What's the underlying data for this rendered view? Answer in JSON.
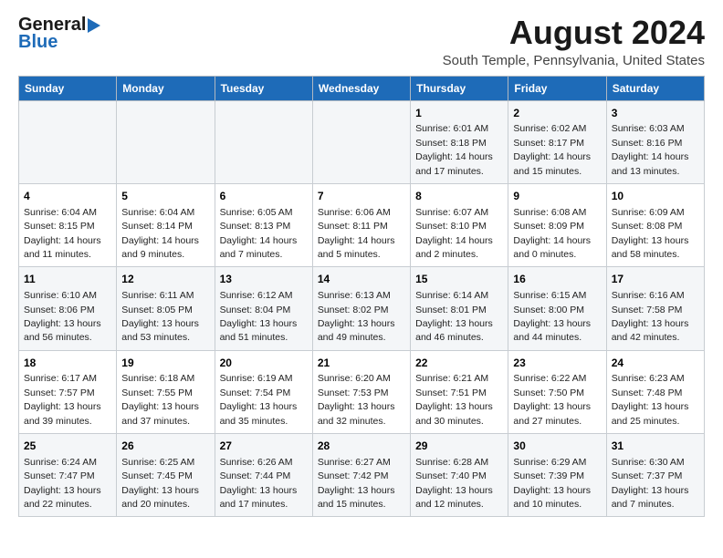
{
  "header": {
    "logo_line1": "General",
    "logo_line2": "Blue",
    "title": "August 2024",
    "subtitle": "South Temple, Pennsylvania, United States"
  },
  "calendar": {
    "days_of_week": [
      "Sunday",
      "Monday",
      "Tuesday",
      "Wednesday",
      "Thursday",
      "Friday",
      "Saturday"
    ],
    "weeks": [
      [
        {
          "day": "",
          "info": ""
        },
        {
          "day": "",
          "info": ""
        },
        {
          "day": "",
          "info": ""
        },
        {
          "day": "",
          "info": ""
        },
        {
          "day": "1",
          "info": "Sunrise: 6:01 AM\nSunset: 8:18 PM\nDaylight: 14 hours\nand 17 minutes."
        },
        {
          "day": "2",
          "info": "Sunrise: 6:02 AM\nSunset: 8:17 PM\nDaylight: 14 hours\nand 15 minutes."
        },
        {
          "day": "3",
          "info": "Sunrise: 6:03 AM\nSunset: 8:16 PM\nDaylight: 14 hours\nand 13 minutes."
        }
      ],
      [
        {
          "day": "4",
          "info": "Sunrise: 6:04 AM\nSunset: 8:15 PM\nDaylight: 14 hours\nand 11 minutes."
        },
        {
          "day": "5",
          "info": "Sunrise: 6:04 AM\nSunset: 8:14 PM\nDaylight: 14 hours\nand 9 minutes."
        },
        {
          "day": "6",
          "info": "Sunrise: 6:05 AM\nSunset: 8:13 PM\nDaylight: 14 hours\nand 7 minutes."
        },
        {
          "day": "7",
          "info": "Sunrise: 6:06 AM\nSunset: 8:11 PM\nDaylight: 14 hours\nand 5 minutes."
        },
        {
          "day": "8",
          "info": "Sunrise: 6:07 AM\nSunset: 8:10 PM\nDaylight: 14 hours\nand 2 minutes."
        },
        {
          "day": "9",
          "info": "Sunrise: 6:08 AM\nSunset: 8:09 PM\nDaylight: 14 hours\nand 0 minutes."
        },
        {
          "day": "10",
          "info": "Sunrise: 6:09 AM\nSunset: 8:08 PM\nDaylight: 13 hours\nand 58 minutes."
        }
      ],
      [
        {
          "day": "11",
          "info": "Sunrise: 6:10 AM\nSunset: 8:06 PM\nDaylight: 13 hours\nand 56 minutes."
        },
        {
          "day": "12",
          "info": "Sunrise: 6:11 AM\nSunset: 8:05 PM\nDaylight: 13 hours\nand 53 minutes."
        },
        {
          "day": "13",
          "info": "Sunrise: 6:12 AM\nSunset: 8:04 PM\nDaylight: 13 hours\nand 51 minutes."
        },
        {
          "day": "14",
          "info": "Sunrise: 6:13 AM\nSunset: 8:02 PM\nDaylight: 13 hours\nand 49 minutes."
        },
        {
          "day": "15",
          "info": "Sunrise: 6:14 AM\nSunset: 8:01 PM\nDaylight: 13 hours\nand 46 minutes."
        },
        {
          "day": "16",
          "info": "Sunrise: 6:15 AM\nSunset: 8:00 PM\nDaylight: 13 hours\nand 44 minutes."
        },
        {
          "day": "17",
          "info": "Sunrise: 6:16 AM\nSunset: 7:58 PM\nDaylight: 13 hours\nand 42 minutes."
        }
      ],
      [
        {
          "day": "18",
          "info": "Sunrise: 6:17 AM\nSunset: 7:57 PM\nDaylight: 13 hours\nand 39 minutes."
        },
        {
          "day": "19",
          "info": "Sunrise: 6:18 AM\nSunset: 7:55 PM\nDaylight: 13 hours\nand 37 minutes."
        },
        {
          "day": "20",
          "info": "Sunrise: 6:19 AM\nSunset: 7:54 PM\nDaylight: 13 hours\nand 35 minutes."
        },
        {
          "day": "21",
          "info": "Sunrise: 6:20 AM\nSunset: 7:53 PM\nDaylight: 13 hours\nand 32 minutes."
        },
        {
          "day": "22",
          "info": "Sunrise: 6:21 AM\nSunset: 7:51 PM\nDaylight: 13 hours\nand 30 minutes."
        },
        {
          "day": "23",
          "info": "Sunrise: 6:22 AM\nSunset: 7:50 PM\nDaylight: 13 hours\nand 27 minutes."
        },
        {
          "day": "24",
          "info": "Sunrise: 6:23 AM\nSunset: 7:48 PM\nDaylight: 13 hours\nand 25 minutes."
        }
      ],
      [
        {
          "day": "25",
          "info": "Sunrise: 6:24 AM\nSunset: 7:47 PM\nDaylight: 13 hours\nand 22 minutes."
        },
        {
          "day": "26",
          "info": "Sunrise: 6:25 AM\nSunset: 7:45 PM\nDaylight: 13 hours\nand 20 minutes."
        },
        {
          "day": "27",
          "info": "Sunrise: 6:26 AM\nSunset: 7:44 PM\nDaylight: 13 hours\nand 17 minutes."
        },
        {
          "day": "28",
          "info": "Sunrise: 6:27 AM\nSunset: 7:42 PM\nDaylight: 13 hours\nand 15 minutes."
        },
        {
          "day": "29",
          "info": "Sunrise: 6:28 AM\nSunset: 7:40 PM\nDaylight: 13 hours\nand 12 minutes."
        },
        {
          "day": "30",
          "info": "Sunrise: 6:29 AM\nSunset: 7:39 PM\nDaylight: 13 hours\nand 10 minutes."
        },
        {
          "day": "31",
          "info": "Sunrise: 6:30 AM\nSunset: 7:37 PM\nDaylight: 13 hours\nand 7 minutes."
        }
      ]
    ]
  }
}
